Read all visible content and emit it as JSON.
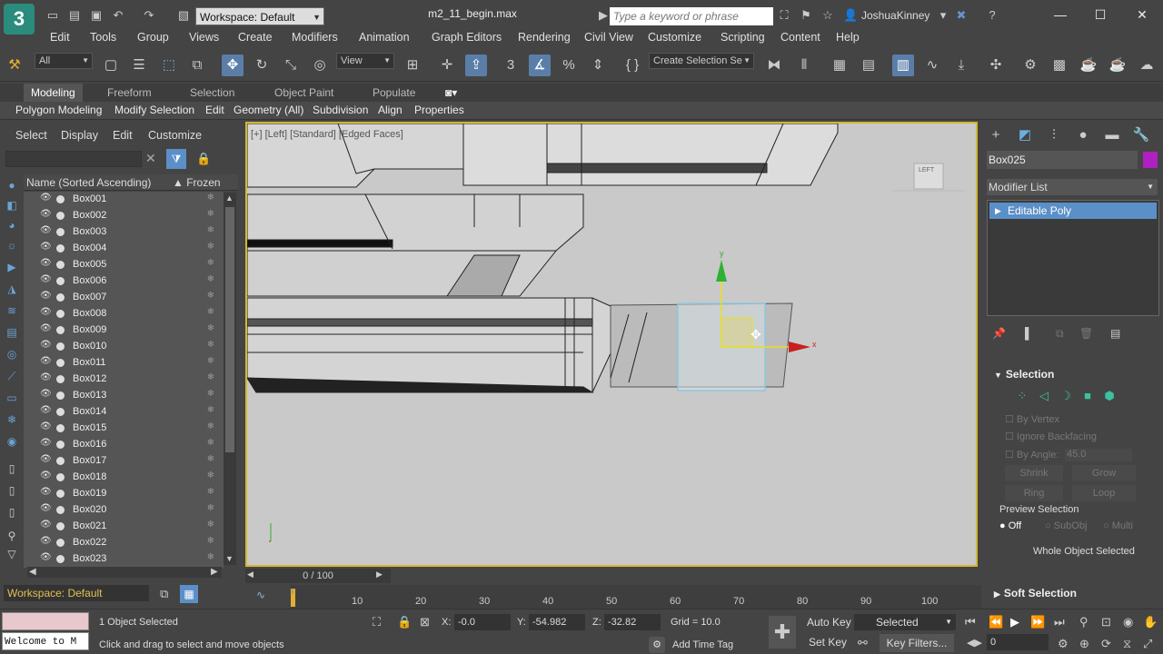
{
  "app": {
    "logo_text": "3",
    "title": "m2_11_begin.max",
    "workspace": "Workspace: Default",
    "search_placeholder": "Type a keyword or phrase",
    "user": "JoshuaKinney"
  },
  "menu": [
    "Edit",
    "Tools",
    "Group",
    "Views",
    "Create",
    "Modifiers",
    "Animation",
    "Graph Editors",
    "Rendering",
    "Civil View",
    "Customize",
    "Scripting",
    "Content",
    "Help"
  ],
  "toolbar": {
    "filter": "All",
    "ref_coord": "View",
    "selection_set": "Create Selection Se"
  },
  "ribbon": {
    "tabs": [
      "Modeling",
      "Freeform",
      "Selection",
      "Object Paint",
      "Populate"
    ],
    "sub": [
      "Polygon Modeling",
      "Modify Selection",
      "Edit",
      "Geometry (All)",
      "Subdivision",
      "Align",
      "Properties"
    ]
  },
  "scene_explorer": {
    "menu": [
      "Select",
      "Display",
      "Edit",
      "Customize"
    ],
    "col_name": "Name (Sorted Ascending)",
    "col_frozen": "▲ Frozen",
    "rows": [
      "Box001",
      "Box002",
      "Box003",
      "Box004",
      "Box005",
      "Box006",
      "Box007",
      "Box008",
      "Box009",
      "Box010",
      "Box011",
      "Box012",
      "Box013",
      "Box014",
      "Box015",
      "Box016",
      "Box017",
      "Box018",
      "Box019",
      "Box020",
      "Box021",
      "Box022",
      "Box023"
    ],
    "workspace": "Workspace: Default"
  },
  "viewport": {
    "label": "[+] [Left] [Standard] [Edged Faces]",
    "viewcube": "LEFT",
    "gizmo_y": "y",
    "gizmo_x": "x"
  },
  "command_panel": {
    "object_name": "Box025",
    "object_color": "#b020c0",
    "modifier_list": "Modifier List",
    "stack_item": "Editable Poly",
    "selection": {
      "title": "Selection",
      "by_vertex": "By Vertex",
      "ignore_backfacing": "Ignore Backfacing",
      "by_angle": "By Angle:",
      "angle": "45.0",
      "shrink": "Shrink",
      "grow": "Grow",
      "ring": "Ring",
      "loop": "Loop",
      "preview": "Preview Selection",
      "off": "Off",
      "subobj": "SubObj",
      "multi": "Multi",
      "status": "Whole Object Selected"
    },
    "soft_selection": "Soft Selection"
  },
  "timeline": {
    "slider": "0 / 100",
    "ticks": [
      "10",
      "20",
      "30",
      "40",
      "50",
      "60",
      "70",
      "80",
      "90",
      "100"
    ]
  },
  "status": {
    "selected": "1 Object Selected",
    "hint": "Click and drag to select and move objects",
    "x_label": "X:",
    "x": "-0.0",
    "y_label": "Y:",
    "y": "-54.982",
    "z_label": "Z:",
    "z": "-32.82",
    "grid": "Grid = 10.0",
    "add_time_tag": "Add Time Tag",
    "auto_key": "Auto Key",
    "set_key": "Set Key",
    "selected_dd": "Selected",
    "key_filters": "Key Filters...",
    "frame": "0",
    "maxscript": "Welcome to M"
  }
}
